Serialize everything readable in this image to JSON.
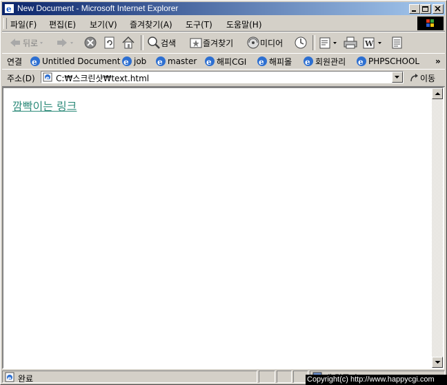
{
  "window": {
    "title": "New Document - Microsoft Internet Explorer"
  },
  "menu": {
    "items": [
      "파일(F)",
      "편집(E)",
      "보기(V)",
      "즐겨찾기(A)",
      "도구(T)",
      "도움말(H)"
    ]
  },
  "toolbar": {
    "back_label": "뒤로",
    "search_label": "검색",
    "favorites_label": "즐겨찾기",
    "media_label": "미디어"
  },
  "links": {
    "label": "연결",
    "items": [
      "Untitled Document",
      "job",
      "master",
      "해피CGI",
      "해피몰",
      "회원관리",
      "PHPSCHOOL"
    ],
    "more": "»"
  },
  "address": {
    "label": "주소(D)",
    "value": "C:₩스크린샷₩text.html",
    "go_label": "이동"
  },
  "page": {
    "link_text": "깜빡이는 링크",
    "link_color": "#2e8b7a"
  },
  "status": {
    "text": "완료",
    "zone": "내 컴퓨터"
  },
  "overlay": {
    "copyright": "Copyright(c) http://www.happycgi.com"
  }
}
